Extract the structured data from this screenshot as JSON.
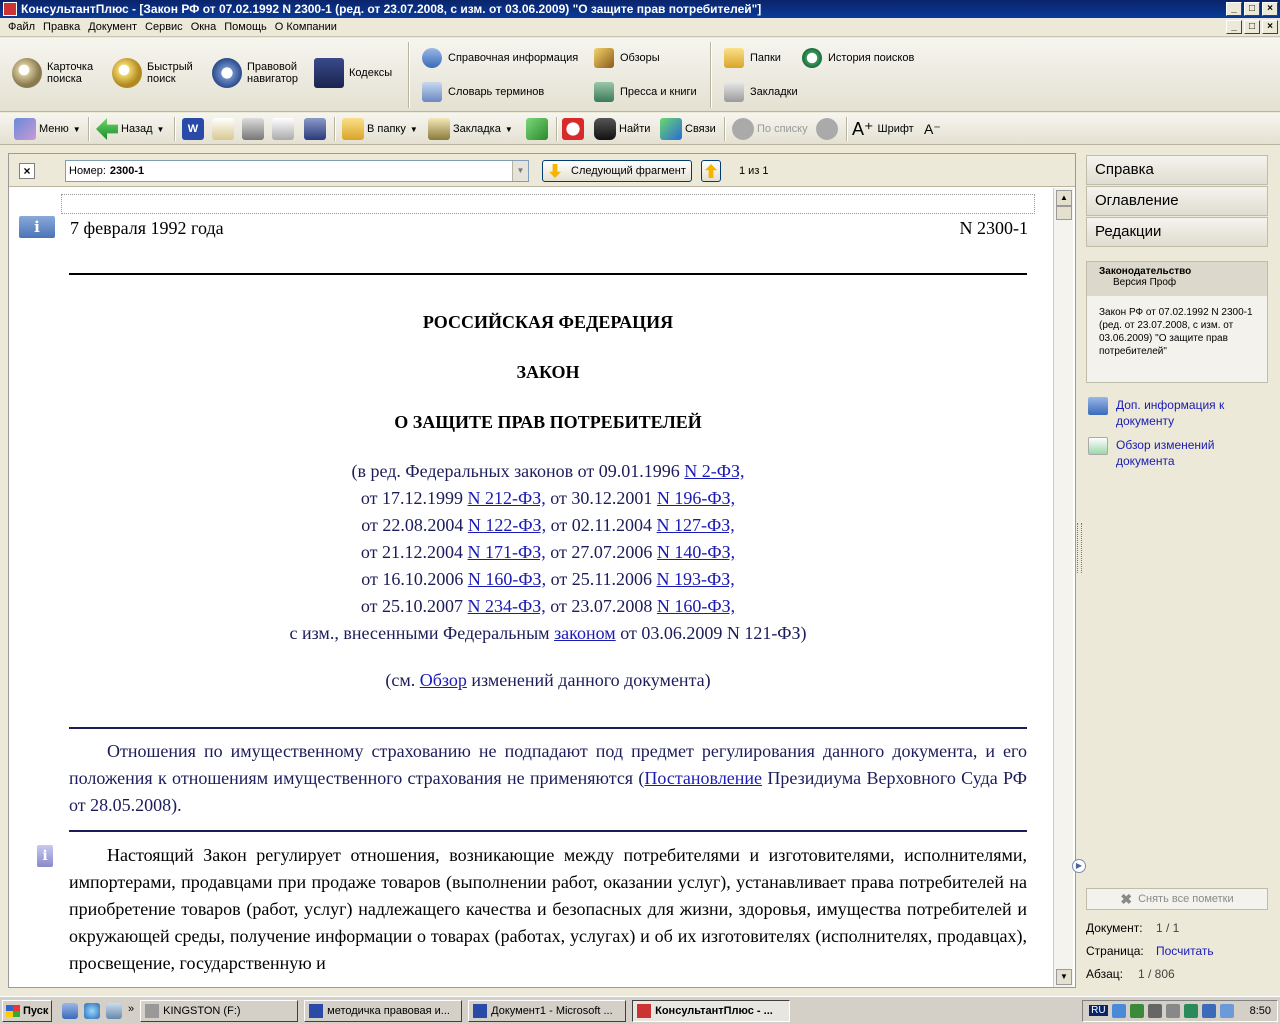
{
  "window": {
    "title": "КонсультантПлюс - [Закон РФ от 07.02.1992 N 2300-1 (ред. от 23.07.2008, с изм. от 03.06.2009) \"О защите прав потребителей\"]"
  },
  "menu": [
    "Файл",
    "Правка",
    "Документ",
    "Сервис",
    "Окна",
    "Помощь",
    "О Компании"
  ],
  "bigbar": {
    "card_search": "Карточка поиска",
    "quick_search": "Быстрый поиск",
    "legal_nav": "Правовой навигатор",
    "codes": "Кодексы",
    "reference": "Справочная информация",
    "reviews": "Обзоры",
    "folders": "Папки",
    "history": "История поисков",
    "dictionary": "Словарь терминов",
    "press": "Пресса и книги",
    "bookmarks": "Закладки"
  },
  "toolbar": {
    "menu": "Меню",
    "back": "Назад",
    "to_folder": "В папку",
    "bookmark": "Закладка",
    "find": "Найти",
    "links": "Связи",
    "by_list": "По списку",
    "font": "Шрифт"
  },
  "searchbar": {
    "number_label": "Номер:",
    "number_value": "2300-1",
    "next_fragment": "Следующий фрагмент",
    "counter": "1 из 1"
  },
  "doc": {
    "date": "7 февраля 1992 года",
    "number": "N 2300-1",
    "country": "РОССИЙСКАЯ ФЕДЕРАЦИЯ",
    "law": "ЗАКОН",
    "title": "О ЗАЩИТЕ ПРАВ ПОТРЕБИТЕЛЕЙ",
    "edits": [
      {
        "pre": "(в ред. Федеральных законов от 09.01.1996 ",
        "link1": "N 2-ФЗ,",
        "mid": "",
        "link2": ""
      },
      {
        "pre": "от 17.12.1999 ",
        "link1": "N 212-ФЗ,",
        "mid": " от 30.12.2001 ",
        "link2": "N 196-ФЗ,"
      },
      {
        "pre": "от 22.08.2004 ",
        "link1": "N 122-ФЗ,",
        "mid": " от 02.11.2004 ",
        "link2": "N 127-ФЗ,"
      },
      {
        "pre": "от 21.12.2004 ",
        "link1": "N 171-ФЗ,",
        "mid": " от 27.07.2006 ",
        "link2": "N 140-ФЗ,"
      },
      {
        "pre": "от 16.10.2006 ",
        "link1": "N 160-ФЗ,",
        "mid": " от 25.11.2006 ",
        "link2": "N 193-ФЗ,"
      },
      {
        "pre": "от 25.10.2007 ",
        "link1": "N 234-ФЗ,",
        "mid": " от 23.07.2008 ",
        "link2": "N 160-ФЗ,"
      }
    ],
    "amend_pre": "с изм., внесенными Федеральным ",
    "amend_link": "законом",
    "amend_post": " от 03.06.2009 N 121-ФЗ)",
    "see_pre": "(см. ",
    "see_link": "Обзор",
    "see_post": " изменений данного документа)",
    "note_text": "Отношения по имущественному страхованию не подпадают под предмет регулирования данного документа, и его положения к отношениям имущественного страхования не применяются (",
    "note_link": "Постановление",
    "note_post": " Президиума Верховного Суда РФ от 28.05.2008).",
    "body": "Настоящий Закон регулирует отношения, возникающие между потребителями и изготовителями, исполнителями, импортерами, продавцами при продаже товаров (выполнении работ, оказании услуг), устанавливает права потребителей на приобретение товаров (работ, услуг) надлежащего качества и безопасных для жизни, здоровья, имущества потребителей и окружающей среды, получение информации о товарах (работах, услугах) и об их изготовителях (исполнителях, продавцах), просвещение, государственную и"
  },
  "right": {
    "tabs": [
      "Справка",
      "Оглавление",
      "Редакции"
    ],
    "info_title": "Законодательство",
    "info_subtitle": "Версия Проф",
    "info_text": "Закон РФ от 07.02.1992 N 2300-1 (ред. от 23.07.2008, с изм. от 03.06.2009) \"О защите прав потребителей\"",
    "link_info": "Доп. информация к документу",
    "link_review": "Обзор изменений документа",
    "clear_marks": "Снять все пометки",
    "doc_label": "Документ:",
    "doc_value": "1 / 1",
    "page_label": "Страница:",
    "page_value": "Посчитать",
    "para_label": "Абзац:",
    "para_value": "1 / 806"
  },
  "taskbar": {
    "start": "Пуск",
    "tasks": [
      "KINGSTON (F:)",
      "методичка правовая и...",
      "Документ1 - Microsoft ...",
      "КонсультантПлюс - ..."
    ],
    "clock": "8:50",
    "lang": "RU"
  }
}
